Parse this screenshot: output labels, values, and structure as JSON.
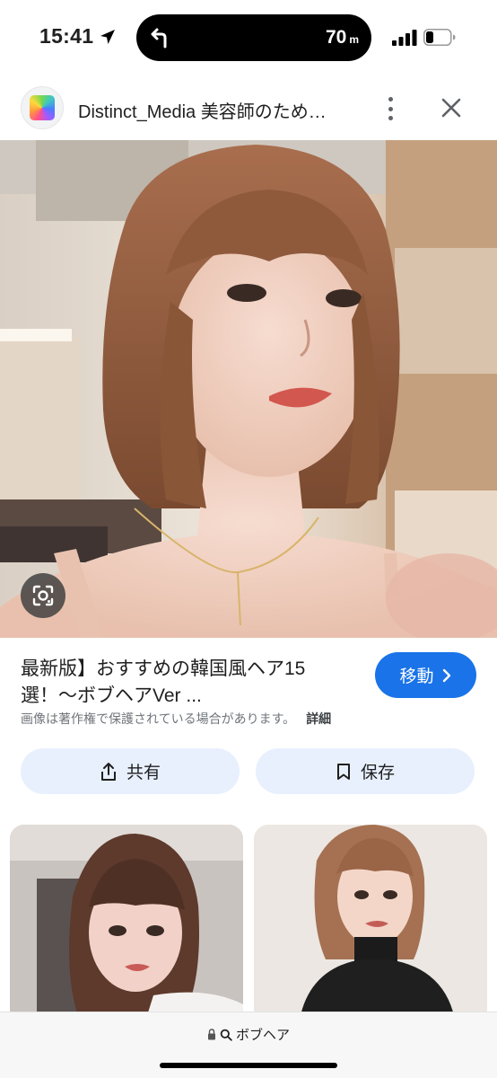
{
  "status_bar": {
    "time": "15:41",
    "navigation_distance": "70",
    "navigation_unit": "m"
  },
  "header": {
    "site_title": "Distinct_Media 美容師のため…",
    "site_icon": "photo-gallery-icon",
    "more_icon": "more-vert-icon",
    "close_icon": "close-icon"
  },
  "result": {
    "title": "最新版】おすすめの韓国風ヘア15選！〜ボブヘアVer ...",
    "visit_label": "移動",
    "copyright_notice": "画像は著作権で保護されている場合があります。",
    "details_label": "詳細",
    "share_label": "共有",
    "save_label": "保存"
  },
  "bottom_bar": {
    "query": "ボブヘア"
  },
  "colors": {
    "accent": "#1a73e8",
    "pill_background": "#e8f0fe",
    "muted_text": "#70757a"
  }
}
